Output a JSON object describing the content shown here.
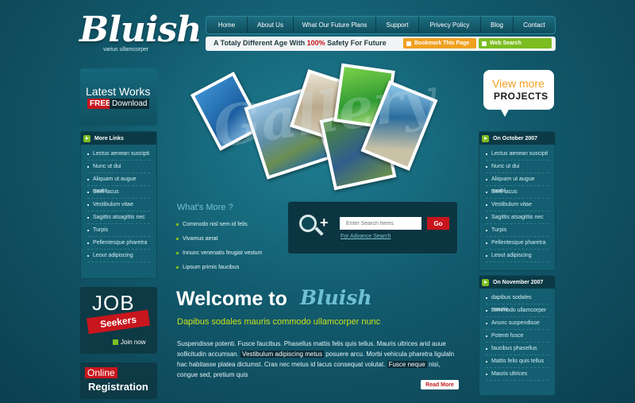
{
  "logo": {
    "name": "Bluish",
    "tagline": "varius ullamcorper"
  },
  "nav": {
    "items": [
      "Home",
      "About Us",
      "What Our Future Plans",
      "Support",
      "Privecy Policy",
      "Blog",
      "Contact"
    ]
  },
  "tagline_bar": {
    "text_before": "A Totaly Different Age With ",
    "highlight": "100%",
    "text_after": " Safety For Future",
    "bookmark_label": "Bookmark This Page",
    "websearch_label": "Web Search"
  },
  "latest_works": {
    "title": "Latest Works",
    "free": "FREE",
    "download": "Download"
  },
  "more_links": {
    "title": "More Links",
    "items": [
      "Lectus aenean suscipit",
      "Nunc ut dui",
      "Aliquam ut augue morbi",
      "Sem lacus",
      "Vestibulum vitae",
      "Sagittis atsagittis nec",
      "Turpis",
      "Pellentesque pharetra",
      "Leout adipiscing"
    ]
  },
  "job": {
    "title": "JOB",
    "seekers": "Seekers",
    "join": "Join now"
  },
  "registration": {
    "online": "Online",
    "title": "Registration"
  },
  "view_more": {
    "line1": "View more",
    "line2": "PROJECTS"
  },
  "oct_panel": {
    "title": "On October 2007",
    "items": [
      "Lectus aenean suscipit",
      "Nunc ut dui",
      "Aliquam ut augue morbi",
      "Sem lacus",
      "Vestibulum vitae",
      "Sagittis atsagittis nec",
      "Turpis",
      "Pellentesque pharetra",
      "Leout adipiscing"
    ]
  },
  "nov_panel": {
    "title": "On November 2007",
    "items": [
      "dapibus sodales mauris",
      "commodo ullamcorper",
      "Anunc suspendisse",
      "Potenti fusce",
      "faucibus phasellus",
      "Mattis felis quis tellus",
      "Mauris ultrices"
    ]
  },
  "gallery": {
    "watermark": "Gallery"
  },
  "whats_more": {
    "title": "What's More ?",
    "items": [
      "Commodo nisl sem id felis",
      "Vivamus aerat",
      "Innunc venenatis feugiat vestum",
      "Lipsum primis faucibus"
    ]
  },
  "search": {
    "placeholder": "Enter Search Items",
    "go": "Go",
    "advance": "For Advance Search"
  },
  "welcome": {
    "title": "Welcome to",
    "brand": "Bluish",
    "subhead": "Dapibus sodales mauris commodo ullamcorper nunc",
    "para_1": "Suspendisse potenti. Fusce faucibus. Phasellus mattis felis quis tellus. Mauris ultrices arid auue sollicitudin accumsan. ",
    "para_hl1": "Vestibulum adipiscing metus",
    "para_2": " posuere arcu. Morbi vehicula pharetra ligulaln hac habitasse platea dictumst. Cras nec metus id lacus consequat volutat. ",
    "para_hl2": "Fusce neque",
    "para_3": " nisi, congue sed, pretium quis",
    "read_more": "Read More"
  }
}
